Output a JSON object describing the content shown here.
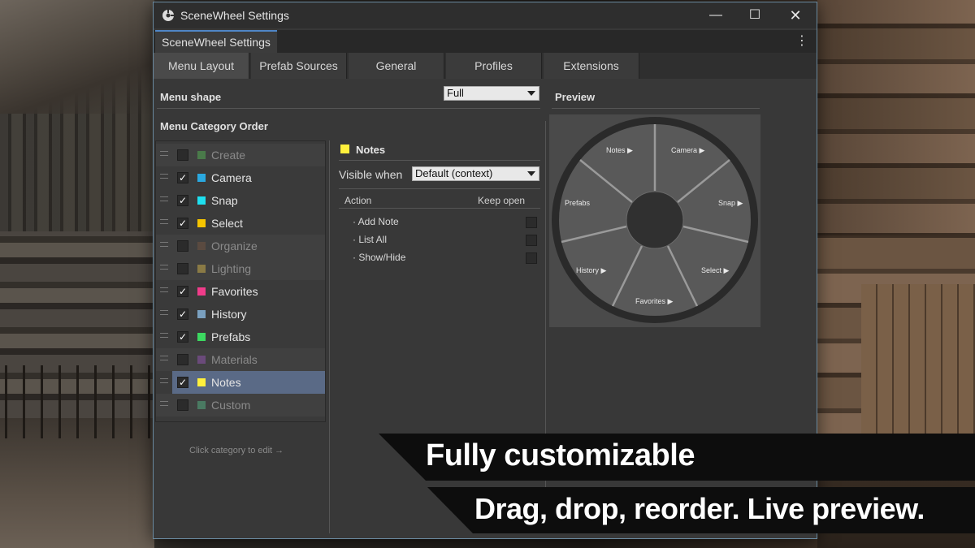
{
  "window": {
    "title": "SceneWheel Settings",
    "doc_tab": "SceneWheel Settings",
    "minimize_glyph": "—",
    "maximize_glyph": "☐",
    "close_glyph": "✕",
    "more_glyph": "⋮"
  },
  "tabs": [
    {
      "label": "Menu Layout",
      "active": true
    },
    {
      "label": "Prefab Sources"
    },
    {
      "label": "General"
    },
    {
      "label": "Profiles"
    },
    {
      "label": "Extensions"
    }
  ],
  "layout": {
    "menu_shape_label": "Menu shape",
    "menu_shape_value": "Full",
    "category_order_label": "Menu Category Order",
    "hint": "Click category to edit →",
    "preview_label": "Preview"
  },
  "categories": [
    {
      "label": "Create",
      "checked": false,
      "color": "#4a7a4a"
    },
    {
      "label": "Camera",
      "checked": true,
      "color": "#2aa8e0"
    },
    {
      "label": "Snap",
      "checked": true,
      "color": "#1ee0f0"
    },
    {
      "label": "Select",
      "checked": true,
      "color": "#f5c400"
    },
    {
      "label": "Organize",
      "checked": false,
      "color": "#5a4a40"
    },
    {
      "label": "Lighting",
      "checked": false,
      "color": "#8a7a45"
    },
    {
      "label": "Favorites",
      "checked": true,
      "color": "#f03c8a"
    },
    {
      "label": "History",
      "checked": true,
      "color": "#7aa0c0"
    },
    {
      "label": "Prefabs",
      "checked": true,
      "color": "#3cd860"
    },
    {
      "label": "Materials",
      "checked": false,
      "color": "#6a4a7a"
    },
    {
      "label": "Notes",
      "checked": true,
      "color": "#fff03c",
      "selected": true
    },
    {
      "label": "Custom",
      "checked": false,
      "color": "#4a7a62"
    }
  ],
  "detail": {
    "title": "Notes",
    "visible_when_label": "Visible when",
    "visible_when_value": "Default (context)",
    "col_action": "Action",
    "col_keep_open": "Keep open",
    "actions": [
      "· Add Note",
      "· List All",
      "· Show/Hide"
    ]
  },
  "preview": {
    "segments": [
      "Notes ▶",
      "Camera ▶",
      "Snap ▶",
      "Select ▶",
      "Favorites ▶",
      "History ▶",
      "Prefabs"
    ]
  },
  "banner": {
    "headline": "Fully customizable",
    "subline": "Drag, drop, reorder. Live preview."
  }
}
